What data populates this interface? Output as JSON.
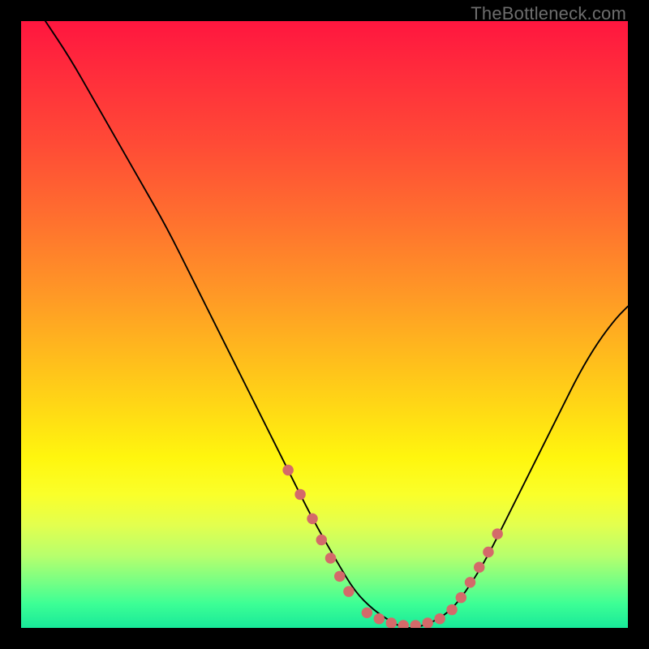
{
  "watermark": "TheBottleneck.com",
  "chart_data": {
    "type": "line",
    "title": "",
    "xlabel": "",
    "ylabel": "",
    "xlim": [
      0,
      100
    ],
    "ylim": [
      0,
      100
    ],
    "grid": false,
    "legend": false,
    "series": [
      {
        "name": "bottleneck-curve",
        "x": [
          4,
          8,
          12,
          16,
          20,
          24,
          28,
          32,
          36,
          40,
          44,
          48,
          52,
          55,
          58,
          61,
          63,
          65,
          68,
          71,
          74,
          77,
          80,
          83,
          86,
          89,
          92,
          95,
          98,
          100
        ],
        "y": [
          100,
          94,
          87,
          80,
          73,
          66,
          58,
          50,
          42,
          34,
          26,
          18,
          11,
          6,
          3,
          1,
          0,
          0,
          1,
          3,
          7,
          12,
          18,
          24,
          30,
          36,
          42,
          47,
          51,
          53
        ]
      }
    ],
    "flat_region_dots": {
      "name": "curve-dots",
      "color": "#d46a6a",
      "radius_pct": 0.9,
      "points": [
        {
          "x": 44,
          "y": 26
        },
        {
          "x": 46,
          "y": 22
        },
        {
          "x": 48,
          "y": 18
        },
        {
          "x": 49.5,
          "y": 14.5
        },
        {
          "x": 51,
          "y": 11.5
        },
        {
          "x": 52.5,
          "y": 8.5
        },
        {
          "x": 54,
          "y": 6
        },
        {
          "x": 57,
          "y": 2.5
        },
        {
          "x": 59,
          "y": 1.5
        },
        {
          "x": 61,
          "y": 0.8
        },
        {
          "x": 63,
          "y": 0.4
        },
        {
          "x": 65,
          "y": 0.4
        },
        {
          "x": 67,
          "y": 0.8
        },
        {
          "x": 69,
          "y": 1.5
        },
        {
          "x": 71,
          "y": 3
        },
        {
          "x": 72.5,
          "y": 5
        },
        {
          "x": 74,
          "y": 7.5
        },
        {
          "x": 75.5,
          "y": 10
        },
        {
          "x": 77,
          "y": 12.5
        },
        {
          "x": 78.5,
          "y": 15.5
        }
      ]
    },
    "curve_color": "#000000",
    "curve_width_pct": 0.25
  }
}
